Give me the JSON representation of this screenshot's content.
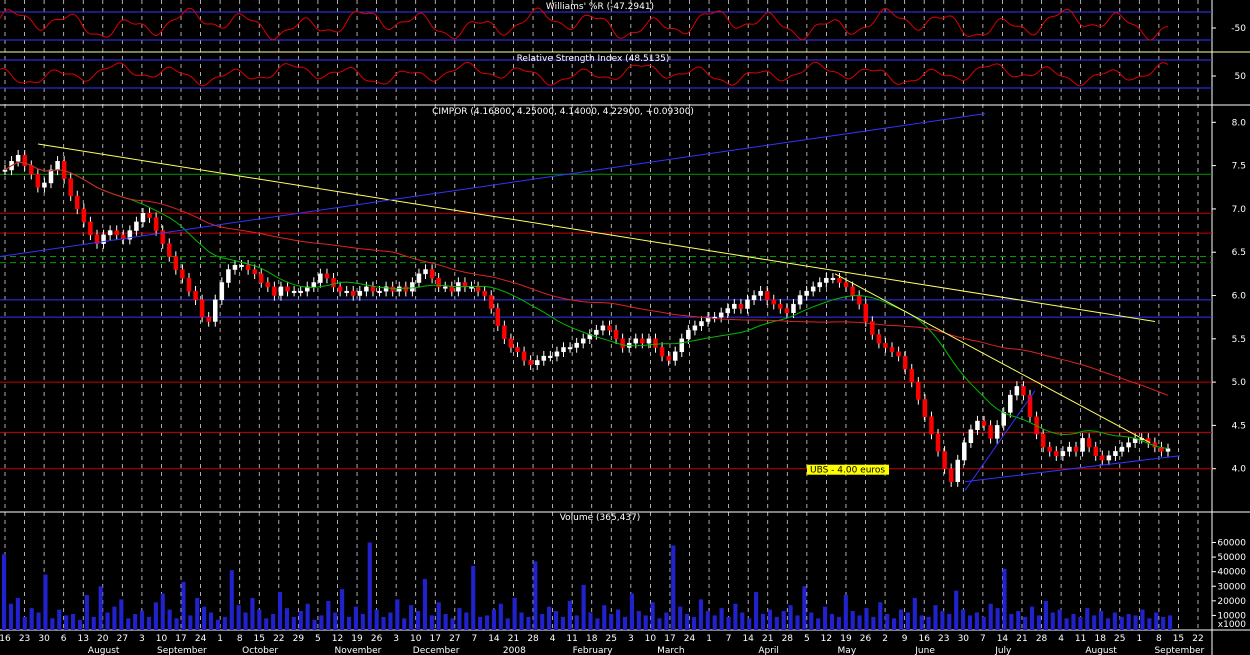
{
  "chart_data": {
    "type": "candlestick",
    "panels": [
      {
        "id": "williams",
        "title": "Williams' %R (-47.2941)",
        "ticks": [
          {
            "label": "-50",
            "value": -50
          }
        ]
      },
      {
        "id": "rsi",
        "title": "Relative Strength Index (48.5135)",
        "ticks": [
          {
            "label": "50",
            "value": 50
          }
        ]
      },
      {
        "id": "price",
        "title": "CIMPOR (4.16800, 4.25000, 4.14000, 4.22900, +0.09300)",
        "ylim": [
          3.5,
          8.2
        ],
        "ticks": [
          {
            "label": "8.0",
            "value": 8.0
          },
          {
            "label": "7.5",
            "value": 7.5
          },
          {
            "label": "7.0",
            "value": 7.0
          },
          {
            "label": "6.5",
            "value": 6.5
          },
          {
            "label": "6.0",
            "value": 6.0
          },
          {
            "label": "5.5",
            "value": 5.5
          },
          {
            "label": "5.0",
            "value": 5.0
          },
          {
            "label": "4.5",
            "value": 4.5
          },
          {
            "label": "4.0",
            "value": 4.0
          }
        ],
        "annotation": "UBS -    4.00 euros"
      },
      {
        "id": "volume",
        "title": "Volume (365,437)",
        "ylim": [
          0,
          72000
        ],
        "ticks": [
          {
            "label": "60000",
            "value": 60000
          },
          {
            "label": "50000",
            "value": 50000
          },
          {
            "label": "40000",
            "value": 40000
          },
          {
            "label": "30000",
            "value": 30000
          },
          {
            "label": "20000",
            "value": 20000
          },
          {
            "label": "10000",
            "value": 10000
          }
        ],
        "scale_note": "x1000"
      }
    ],
    "x_dates": [
      "16",
      "23",
      "30",
      "6",
      "13",
      "20",
      "27",
      "3",
      "10",
      "17",
      "24",
      "1",
      "8",
      "15",
      "22",
      "29",
      "5",
      "12",
      "19",
      "26",
      "3",
      "10",
      "17",
      "27",
      "7",
      "14",
      "21",
      "28",
      "4",
      "11",
      "18",
      "25",
      "3",
      "10",
      "17",
      "24",
      "1",
      "7",
      "14",
      "21",
      "28",
      "5",
      "12",
      "19",
      "26",
      "2",
      "9",
      "16",
      "23",
      "30",
      "7",
      "14",
      "21",
      "28",
      "4",
      "11",
      "18",
      "25",
      "1",
      "8",
      "15",
      "22"
    ],
    "x_months": [
      "August",
      "September",
      "October",
      "November",
      "December",
      "2008",
      "February",
      "March",
      "April",
      "May",
      "June",
      "July",
      "August",
      "September"
    ],
    "price_series": [
      7.45,
      7.55,
      7.62,
      7.5,
      7.4,
      7.25,
      7.3,
      7.45,
      7.55,
      7.35,
      7.15,
      7.0,
      6.85,
      6.7,
      6.6,
      6.7,
      6.75,
      6.7,
      6.65,
      6.75,
      6.85,
      6.95,
      6.9,
      6.75,
      6.6,
      6.45,
      6.3,
      6.2,
      6.05,
      5.95,
      5.75,
      5.7,
      5.95,
      6.15,
      6.3,
      6.35,
      6.35,
      6.3,
      6.25,
      6.15,
      6.1,
      6.0,
      6.1,
      6.05,
      6.05,
      6.05,
      6.1,
      6.15,
      6.25,
      6.2,
      6.1,
      6.05,
      6.05,
      6.0,
      6.05,
      6.1,
      6.05,
      6.05,
      6.1,
      6.05,
      6.1,
      6.05,
      6.15,
      6.25,
      6.3,
      6.2,
      6.1,
      6.1,
      6.05,
      6.15,
      6.1,
      6.1,
      6.05,
      6.0,
      5.85,
      5.65,
      5.5,
      5.4,
      5.35,
      5.25,
      5.2,
      5.25,
      5.3,
      5.3,
      5.35,
      5.4,
      5.4,
      5.45,
      5.5,
      5.55,
      5.6,
      5.65,
      5.6,
      5.5,
      5.4,
      5.45,
      5.5,
      5.45,
      5.5,
      5.4,
      5.3,
      5.25,
      5.35,
      5.5,
      5.6,
      5.65,
      5.7,
      5.75,
      5.75,
      5.8,
      5.85,
      5.9,
      5.85,
      5.95,
      6.0,
      6.05,
      5.95,
      5.9,
      5.85,
      5.8,
      5.9,
      6.0,
      6.05,
      6.1,
      6.15,
      6.2,
      6.2,
      6.15,
      6.1,
      6.0,
      5.9,
      5.7,
      5.55,
      5.45,
      5.4,
      5.35,
      5.3,
      5.15,
      5.0,
      4.8,
      4.6,
      4.4,
      4.2,
      4.0,
      3.85,
      4.1,
      4.3,
      4.45,
      4.55,
      4.5,
      4.35,
      4.5,
      4.65,
      4.85,
      4.95,
      4.85,
      4.6,
      4.4,
      4.25,
      4.2,
      4.15,
      4.2,
      4.25,
      4.2,
      4.35,
      4.25,
      4.15,
      4.1,
      4.15,
      4.2,
      4.25,
      4.3,
      4.35,
      4.35,
      4.3,
      4.25,
      4.2,
      4.23
    ],
    "volume_series": [
      52000,
      18000,
      22000,
      9000,
      15000,
      12000,
      38000,
      8000,
      14000,
      10000,
      11000,
      7000,
      24000,
      9000,
      30000,
      12000,
      16000,
      21000,
      8000,
      11000,
      13000,
      9000,
      19000,
      25000,
      14000,
      8000,
      33000,
      10000,
      22000,
      16000,
      12000,
      7000,
      9000,
      41000,
      17000,
      12000,
      22000,
      14000,
      8000,
      11000,
      26000,
      15000,
      9000,
      13000,
      18000,
      7000,
      10000,
      20000,
      12000,
      28000,
      9000,
      16000,
      11000,
      60000,
      14000,
      9000,
      12000,
      21000,
      8000,
      17000,
      13000,
      35000,
      10000,
      19000,
      11000,
      8000,
      15000,
      12000,
      44000,
      9000,
      10000,
      14000,
      18000,
      8000,
      22000,
      12000,
      9000,
      47000,
      11000,
      16000,
      13000,
      9000,
      20000,
      10000,
      31000,
      12000,
      8000,
      17000,
      11000,
      14000,
      9000,
      25000,
      13000,
      10000,
      19000,
      8000,
      12000,
      58000,
      16000,
      11000,
      9000,
      21000,
      13000,
      10000,
      15000,
      9000,
      18000,
      12000,
      8000,
      26000,
      11000,
      14000,
      9000,
      13000,
      17000,
      10000,
      30000,
      12000,
      8000,
      16000,
      11000,
      9000,
      24000,
      13000,
      10000,
      15000,
      9000,
      19000,
      11000,
      8000,
      14000,
      12000,
      22000,
      10000,
      9000,
      17000,
      13000,
      11000,
      27000,
      14000,
      10000,
      12000,
      9000,
      18000,
      15000,
      42000,
      11000,
      13000,
      9000,
      16000,
      10000,
      20000,
      12000,
      14000,
      8000,
      11000,
      9000,
      15000,
      10000,
      13000,
      8000,
      12000,
      9000,
      11000,
      10000,
      14000,
      8000,
      12000,
      9000,
      10000
    ]
  }
}
